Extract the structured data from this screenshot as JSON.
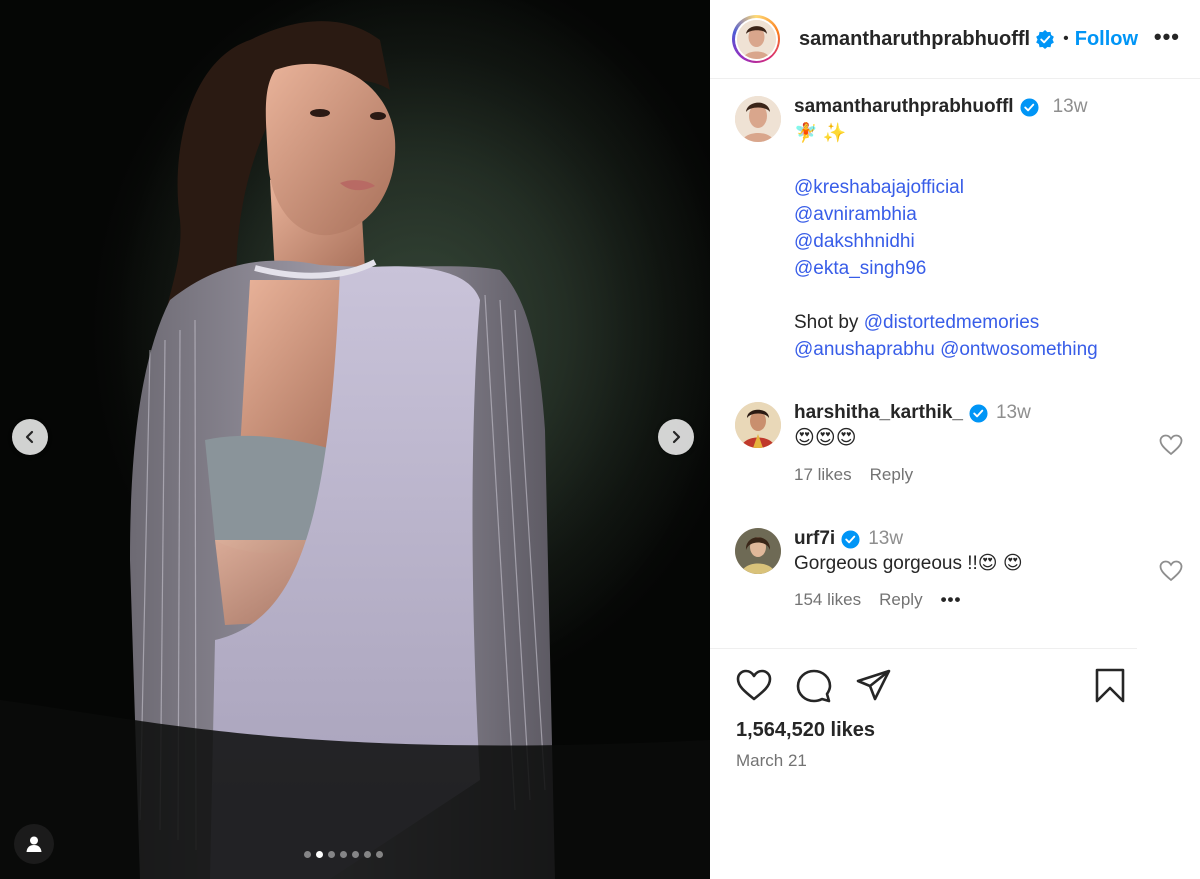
{
  "media": {
    "carousel_total": 7,
    "carousel_active_index": 1
  },
  "post_header": {
    "username": "samantharuthprabhuoffl",
    "separator": "•",
    "follow_label": "Follow",
    "more_label": "•••"
  },
  "caption": {
    "username": "samantharuthprabhuoffl",
    "time": "13w",
    "emoji_line": "🧚 ✨",
    "mentions": [
      "@kreshabajajofficial",
      "@avnirambhia",
      "@dakshhnidhi",
      "@ekta_singh96"
    ],
    "shot_by_prefix": "Shot by",
    "shot_by_mention": "@distortedmemories",
    "extra_mentions": [
      "@anushaprabhu",
      "@ontwosomething"
    ]
  },
  "comments": [
    {
      "username": "harshitha_karthik_",
      "time": "13w",
      "text": "😍😍😍",
      "likes": "17 likes",
      "reply_label": "Reply"
    },
    {
      "username": "urf7i",
      "time": "13w",
      "text": "Gorgeous gorgeous !!😍 😍",
      "likes": "154 likes",
      "reply_label": "Reply",
      "more_label": "•••"
    }
  ],
  "footer": {
    "likes": "1,564,520 likes",
    "date": "March 21"
  },
  "colors": {
    "link": "#385de8",
    "follow": "#0095f6",
    "verified": "#0095f6"
  }
}
